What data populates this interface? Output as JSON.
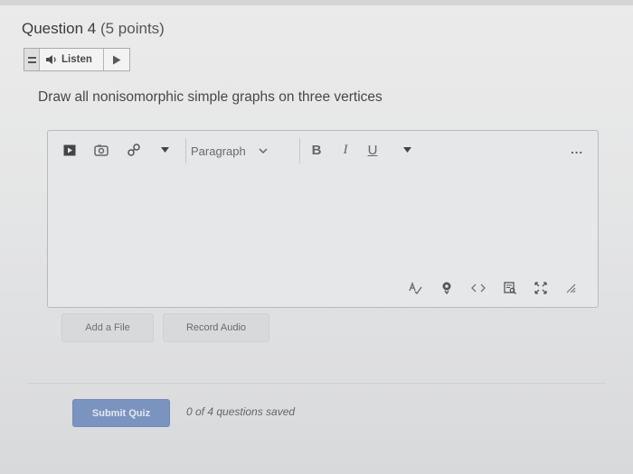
{
  "question": {
    "title": "Question 4",
    "points": "(5 points)"
  },
  "listen": {
    "label": "Listen"
  },
  "prompt": "Draw all nonisomorphic simple graphs on three vertices",
  "editor": {
    "paragraph_label": "Paragraph",
    "bold": "B",
    "italic": "I",
    "underline": "U",
    "more": "..."
  },
  "buttons": {
    "add_file": "Add a File",
    "record_audio": "Record Audio",
    "submit": "Submit Quiz"
  },
  "status": {
    "saved": "0 of 4 questions saved"
  },
  "colors": {
    "submit_bg": "#7b93bf",
    "page_bg": "#e6e7e8"
  }
}
